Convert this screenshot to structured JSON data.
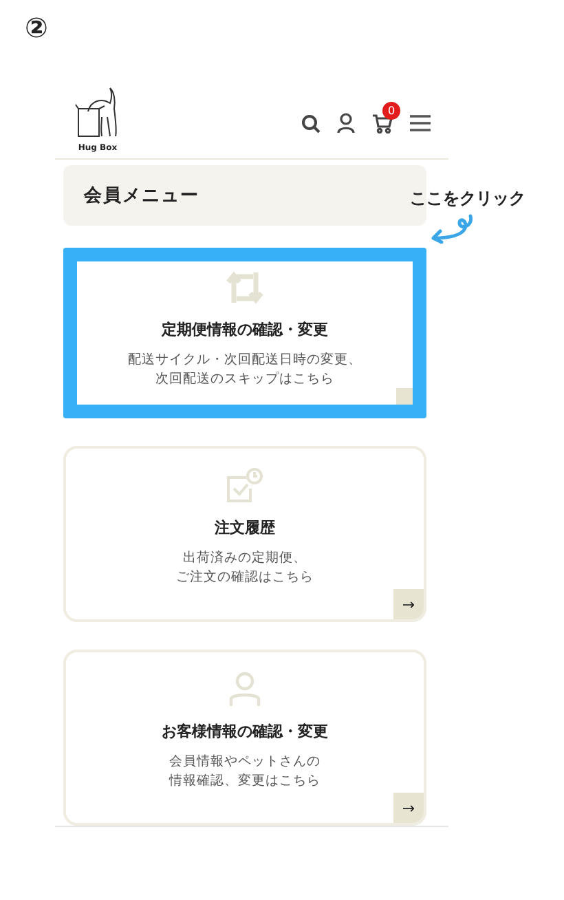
{
  "step": "②",
  "header": {
    "logo": "Hug Box",
    "cart_count": "0"
  },
  "menu_title": "会員メニュー",
  "callout": "ここをクリック",
  "cards": [
    {
      "kind": "repeat",
      "title": "定期便情報の確認・変更",
      "description": [
        "配送サイクル・次回配送日時の変更、",
        "次回配送のスキップはこちら"
      ],
      "highlighted": true
    },
    {
      "kind": "history",
      "title": "注文履歴",
      "description": [
        "出荷済みの定期便、",
        "ご注文の確認はこちら"
      ],
      "highlighted": false,
      "arrow": "→"
    },
    {
      "kind": "person",
      "title": "お客様情報の確認・変更",
      "description": [
        "会員情報やペットさんの",
        "情報確認、変更はこちら"
      ],
      "highlighted": false,
      "arrow": "→"
    }
  ]
}
